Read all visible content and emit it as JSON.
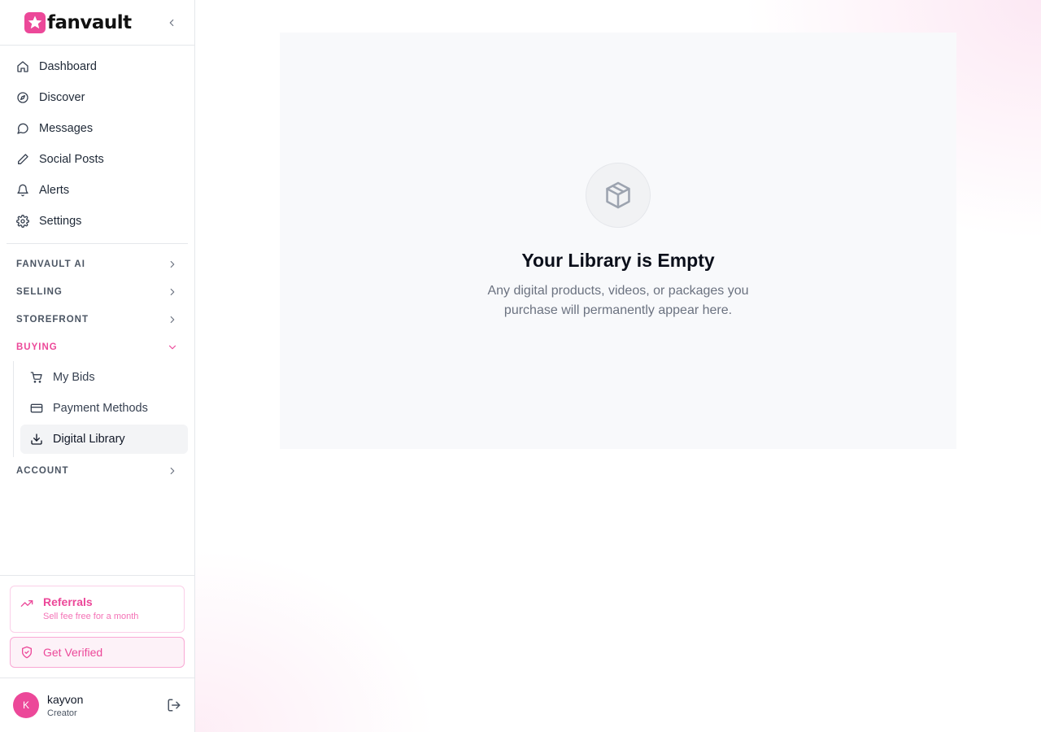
{
  "brand": {
    "name": "fanvault"
  },
  "nav": {
    "items": [
      {
        "label": "Dashboard",
        "icon": "home-icon"
      },
      {
        "label": "Discover",
        "icon": "compass-icon"
      },
      {
        "label": "Messages",
        "icon": "message-icon"
      },
      {
        "label": "Social Posts",
        "icon": "pencil-icon"
      },
      {
        "label": "Alerts",
        "icon": "bell-icon"
      },
      {
        "label": "Settings",
        "icon": "gear-icon"
      }
    ]
  },
  "sections": {
    "fanvault_ai": "FANVAULT AI",
    "selling": "SELLING",
    "storefront": "STOREFRONT",
    "buying": "BUYING",
    "account": "ACCOUNT"
  },
  "buying": {
    "items": [
      {
        "label": "My Bids",
        "icon": "cart-icon"
      },
      {
        "label": "Payment Methods",
        "icon": "credit-card-icon"
      },
      {
        "label": "Digital Library",
        "icon": "download-icon"
      }
    ]
  },
  "referrals": {
    "title": "Referrals",
    "subtitle": "Sell fee free for a month"
  },
  "verify": {
    "label": "Get Verified"
  },
  "user": {
    "initial": "K",
    "name": "kayvon",
    "role": "Creator"
  },
  "library": {
    "title": "Your Library is Empty",
    "description": "Any digital products, videos, or packages you purchase will permanently appear here."
  },
  "colors": {
    "accent": "#ec4899",
    "accent_light": "#fdf2f8",
    "text_muted": "#6b7280"
  }
}
